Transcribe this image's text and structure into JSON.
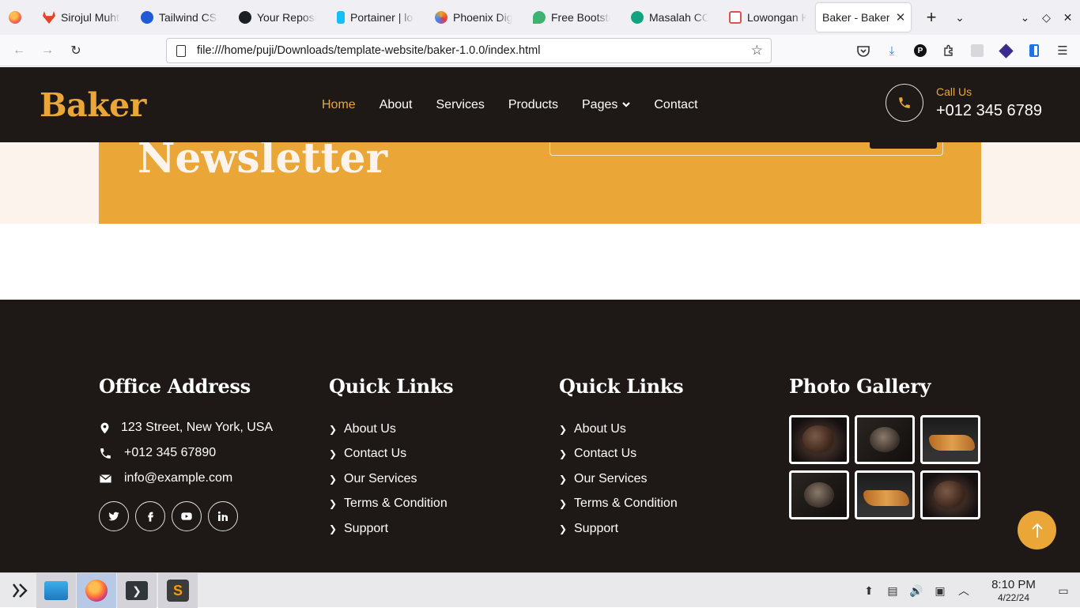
{
  "browser": {
    "tabs": [
      {
        "label": "Sirojul Muhta",
        "favicon_color": "#e24329"
      },
      {
        "label": "Tailwind CSS",
        "favicon_color": "#1e5bd6"
      },
      {
        "label": "Your Reposit",
        "favicon_color": "#1b1f23"
      },
      {
        "label": "Portainer | lo",
        "favicon_color": "#13bef9"
      },
      {
        "label": "Phoenix Digi",
        "favicon_color": "#f4a31a"
      },
      {
        "label": "Free Bootstra",
        "favicon_color": "#3cb371"
      },
      {
        "label": "Masalah COR",
        "favicon_color": "#10a37f"
      },
      {
        "label": "Lowongan K",
        "favicon_color": "#d9534f"
      },
      {
        "label": "Baker - Bakery",
        "favicon_color": "",
        "active": true
      }
    ],
    "url": "file:///home/puji/Downloads/template-website/baker-1.0.0/index.html"
  },
  "site": {
    "logo": "Baker",
    "nav": [
      {
        "label": "Home",
        "active": true
      },
      {
        "label": "About"
      },
      {
        "label": "Services"
      },
      {
        "label": "Products"
      },
      {
        "label": "Pages",
        "dropdown": true
      },
      {
        "label": "Contact"
      }
    ],
    "call_label": "Call Us",
    "call_number": "+012 345 6789",
    "accent_color": "#eaa636",
    "dark_color": "#1e1917"
  },
  "newsletter": {
    "title": "Newsletter"
  },
  "footer": {
    "office": {
      "heading": "Office Address",
      "address": "123 Street, New York, USA",
      "phone": "+012 345 67890",
      "email": "info@example.com",
      "socials": [
        "twitter-icon",
        "facebook-icon",
        "youtube-icon",
        "linkedin-icon"
      ]
    },
    "quick_links_1": {
      "heading": "Quick Links",
      "links": [
        "About Us",
        "Contact Us",
        "Our Services",
        "Terms & Condition",
        "Support"
      ]
    },
    "quick_links_2": {
      "heading": "Quick Links",
      "links": [
        "About Us",
        "Contact Us",
        "Our Services",
        "Terms & Condition",
        "Support"
      ]
    },
    "gallery": {
      "heading": "Photo Gallery",
      "images": [
        "bread",
        "rye",
        "croissant",
        "rye",
        "croissant",
        "bread"
      ]
    }
  },
  "taskbar": {
    "time": "8:10 PM",
    "date": "4/22/24"
  }
}
